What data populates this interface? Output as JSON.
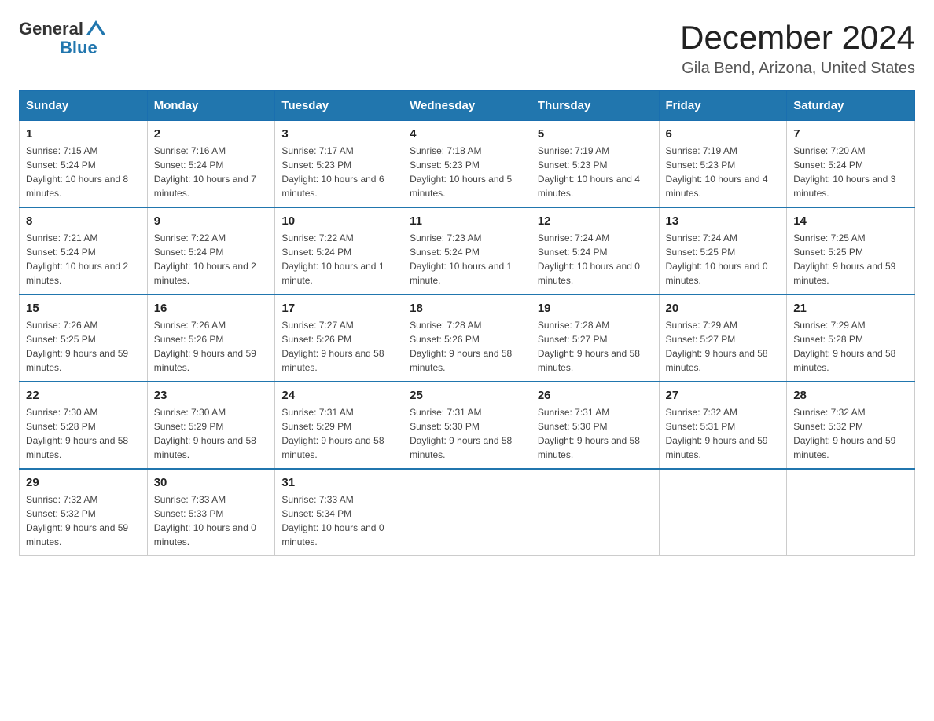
{
  "header": {
    "logo_general": "General",
    "logo_blue": "Blue",
    "title": "December 2024",
    "subtitle": "Gila Bend, Arizona, United States"
  },
  "days_of_week": [
    "Sunday",
    "Monday",
    "Tuesday",
    "Wednesday",
    "Thursday",
    "Friday",
    "Saturday"
  ],
  "weeks": [
    [
      {
        "day": "1",
        "sunrise": "7:15 AM",
        "sunset": "5:24 PM",
        "daylight": "10 hours and 8 minutes."
      },
      {
        "day": "2",
        "sunrise": "7:16 AM",
        "sunset": "5:24 PM",
        "daylight": "10 hours and 7 minutes."
      },
      {
        "day": "3",
        "sunrise": "7:17 AM",
        "sunset": "5:23 PM",
        "daylight": "10 hours and 6 minutes."
      },
      {
        "day": "4",
        "sunrise": "7:18 AM",
        "sunset": "5:23 PM",
        "daylight": "10 hours and 5 minutes."
      },
      {
        "day": "5",
        "sunrise": "7:19 AM",
        "sunset": "5:23 PM",
        "daylight": "10 hours and 4 minutes."
      },
      {
        "day": "6",
        "sunrise": "7:19 AM",
        "sunset": "5:23 PM",
        "daylight": "10 hours and 4 minutes."
      },
      {
        "day": "7",
        "sunrise": "7:20 AM",
        "sunset": "5:24 PM",
        "daylight": "10 hours and 3 minutes."
      }
    ],
    [
      {
        "day": "8",
        "sunrise": "7:21 AM",
        "sunset": "5:24 PM",
        "daylight": "10 hours and 2 minutes."
      },
      {
        "day": "9",
        "sunrise": "7:22 AM",
        "sunset": "5:24 PM",
        "daylight": "10 hours and 2 minutes."
      },
      {
        "day": "10",
        "sunrise": "7:22 AM",
        "sunset": "5:24 PM",
        "daylight": "10 hours and 1 minute."
      },
      {
        "day": "11",
        "sunrise": "7:23 AM",
        "sunset": "5:24 PM",
        "daylight": "10 hours and 1 minute."
      },
      {
        "day": "12",
        "sunrise": "7:24 AM",
        "sunset": "5:24 PM",
        "daylight": "10 hours and 0 minutes."
      },
      {
        "day": "13",
        "sunrise": "7:24 AM",
        "sunset": "5:25 PM",
        "daylight": "10 hours and 0 minutes."
      },
      {
        "day": "14",
        "sunrise": "7:25 AM",
        "sunset": "5:25 PM",
        "daylight": "9 hours and 59 minutes."
      }
    ],
    [
      {
        "day": "15",
        "sunrise": "7:26 AM",
        "sunset": "5:25 PM",
        "daylight": "9 hours and 59 minutes."
      },
      {
        "day": "16",
        "sunrise": "7:26 AM",
        "sunset": "5:26 PM",
        "daylight": "9 hours and 59 minutes."
      },
      {
        "day": "17",
        "sunrise": "7:27 AM",
        "sunset": "5:26 PM",
        "daylight": "9 hours and 58 minutes."
      },
      {
        "day": "18",
        "sunrise": "7:28 AM",
        "sunset": "5:26 PM",
        "daylight": "9 hours and 58 minutes."
      },
      {
        "day": "19",
        "sunrise": "7:28 AM",
        "sunset": "5:27 PM",
        "daylight": "9 hours and 58 minutes."
      },
      {
        "day": "20",
        "sunrise": "7:29 AM",
        "sunset": "5:27 PM",
        "daylight": "9 hours and 58 minutes."
      },
      {
        "day": "21",
        "sunrise": "7:29 AM",
        "sunset": "5:28 PM",
        "daylight": "9 hours and 58 minutes."
      }
    ],
    [
      {
        "day": "22",
        "sunrise": "7:30 AM",
        "sunset": "5:28 PM",
        "daylight": "9 hours and 58 minutes."
      },
      {
        "day": "23",
        "sunrise": "7:30 AM",
        "sunset": "5:29 PM",
        "daylight": "9 hours and 58 minutes."
      },
      {
        "day": "24",
        "sunrise": "7:31 AM",
        "sunset": "5:29 PM",
        "daylight": "9 hours and 58 minutes."
      },
      {
        "day": "25",
        "sunrise": "7:31 AM",
        "sunset": "5:30 PM",
        "daylight": "9 hours and 58 minutes."
      },
      {
        "day": "26",
        "sunrise": "7:31 AM",
        "sunset": "5:30 PM",
        "daylight": "9 hours and 58 minutes."
      },
      {
        "day": "27",
        "sunrise": "7:32 AM",
        "sunset": "5:31 PM",
        "daylight": "9 hours and 59 minutes."
      },
      {
        "day": "28",
        "sunrise": "7:32 AM",
        "sunset": "5:32 PM",
        "daylight": "9 hours and 59 minutes."
      }
    ],
    [
      {
        "day": "29",
        "sunrise": "7:32 AM",
        "sunset": "5:32 PM",
        "daylight": "9 hours and 59 minutes."
      },
      {
        "day": "30",
        "sunrise": "7:33 AM",
        "sunset": "5:33 PM",
        "daylight": "10 hours and 0 minutes."
      },
      {
        "day": "31",
        "sunrise": "7:33 AM",
        "sunset": "5:34 PM",
        "daylight": "10 hours and 0 minutes."
      },
      null,
      null,
      null,
      null
    ]
  ],
  "labels": {
    "sunrise": "Sunrise:",
    "sunset": "Sunset:",
    "daylight": "Daylight:"
  }
}
